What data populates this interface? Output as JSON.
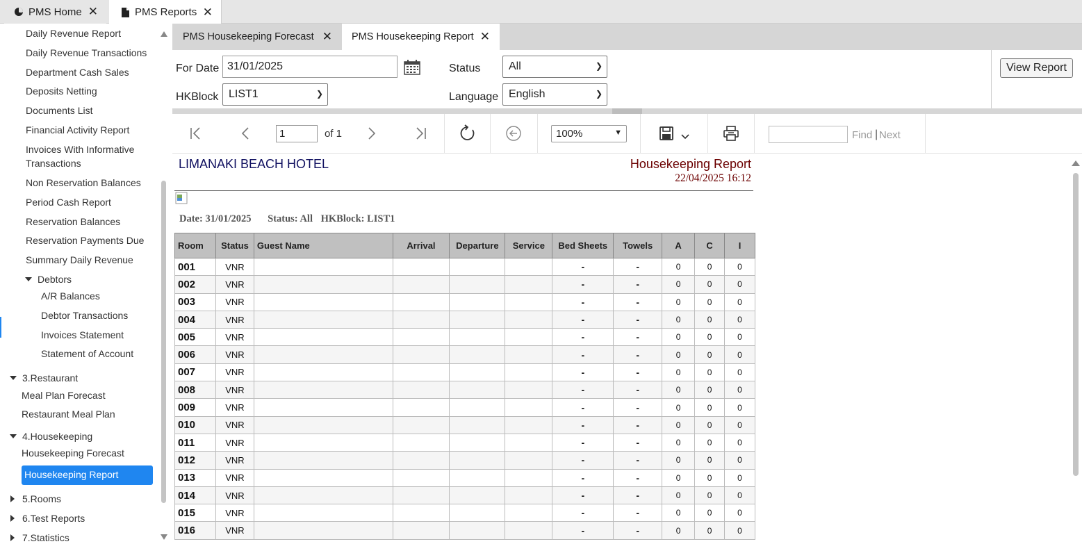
{
  "top_tabs": [
    {
      "label": "PMS Home",
      "icon": "pie-chart-icon"
    },
    {
      "label": "PMS Reports",
      "icon": "document-icon"
    }
  ],
  "sidebar": {
    "items": [
      "Daily Revenue Report",
      "Daily Revenue Transactions",
      "Department Cash Sales",
      "Deposits Netting",
      "Documents List",
      "Financial Activity Report",
      "Invoices With Informative Transactions",
      "Non Reservation Balances",
      "Period Cash Report",
      "Reservation Balances",
      "Reservation Payments Due",
      "Summary Daily Revenue"
    ],
    "debtors_group": "Debtors",
    "debtors_items": [
      "A/R Balances",
      "Debtor Transactions",
      "Invoices Statement",
      "Statement of Account"
    ],
    "restaurant_group": "3.Restaurant",
    "restaurant_items": [
      "Meal Plan Forecast",
      "Restaurant Meal Plan"
    ],
    "housekeeping_group": "4.Housekeeping",
    "housekeeping_items": [
      "Housekeeping Forecast"
    ],
    "active_item": "Housekeeping Report",
    "rooms_group": "5.Rooms",
    "test_group": "6.Test Reports",
    "stats_group": "7.Statistics"
  },
  "inner_tabs": [
    {
      "label": "PMS Housekeeping Forecast"
    },
    {
      "label": "PMS Housekeeping Report"
    }
  ],
  "params": {
    "for_date_label": "For Date",
    "for_date_value": "31/01/2025",
    "status_label": "Status",
    "status_value": "All",
    "hkblock_label": "HKBlock",
    "hkblock_value": "LIST1",
    "language_label": "Language",
    "language_value": "English",
    "view_report_label": "View Report"
  },
  "toolbar": {
    "page_value": "1",
    "of_text": "of 1",
    "zoom_value": "100%",
    "find_label": "Find",
    "next_label": "Next"
  },
  "report": {
    "hotel_name": "LIMANAKI BEACH HOTEL",
    "title": "Housekeeping Report",
    "generated": "22/04/2025 16:12",
    "filter_date": "Date: 31/01/2025",
    "filter_status": "Status:  All",
    "filter_hkblock": "HKBlock: LIST1",
    "columns": [
      "Room",
      "Status",
      "Guest Name",
      "Arrival",
      "Departure",
      "Service",
      "Bed Sheets",
      "Towels",
      "A",
      "C",
      "I"
    ],
    "rows": [
      {
        "room": "001",
        "status": "VNR",
        "guest": "",
        "arrival": "",
        "departure": "",
        "service": "",
        "bed_sheets": "-",
        "towels": "-",
        "a": "0",
        "c": "0",
        "i": "0"
      },
      {
        "room": "002",
        "status": "VNR",
        "guest": "",
        "arrival": "",
        "departure": "",
        "service": "",
        "bed_sheets": "-",
        "towels": "-",
        "a": "0",
        "c": "0",
        "i": "0"
      },
      {
        "room": "003",
        "status": "VNR",
        "guest": "",
        "arrival": "",
        "departure": "",
        "service": "",
        "bed_sheets": "-",
        "towels": "-",
        "a": "0",
        "c": "0",
        "i": "0"
      },
      {
        "room": "004",
        "status": "VNR",
        "guest": "",
        "arrival": "",
        "departure": "",
        "service": "",
        "bed_sheets": "-",
        "towels": "-",
        "a": "0",
        "c": "0",
        "i": "0"
      },
      {
        "room": "005",
        "status": "VNR",
        "guest": "",
        "arrival": "",
        "departure": "",
        "service": "",
        "bed_sheets": "-",
        "towels": "-",
        "a": "0",
        "c": "0",
        "i": "0"
      },
      {
        "room": "006",
        "status": "VNR",
        "guest": "",
        "arrival": "",
        "departure": "",
        "service": "",
        "bed_sheets": "-",
        "towels": "-",
        "a": "0",
        "c": "0",
        "i": "0"
      },
      {
        "room": "007",
        "status": "VNR",
        "guest": "",
        "arrival": "",
        "departure": "",
        "service": "",
        "bed_sheets": "-",
        "towels": "-",
        "a": "0",
        "c": "0",
        "i": "0"
      },
      {
        "room": "008",
        "status": "VNR",
        "guest": "",
        "arrival": "",
        "departure": "",
        "service": "",
        "bed_sheets": "-",
        "towels": "-",
        "a": "0",
        "c": "0",
        "i": "0"
      },
      {
        "room": "009",
        "status": "VNR",
        "guest": "",
        "arrival": "",
        "departure": "",
        "service": "",
        "bed_sheets": "-",
        "towels": "-",
        "a": "0",
        "c": "0",
        "i": "0"
      },
      {
        "room": "010",
        "status": "VNR",
        "guest": "",
        "arrival": "",
        "departure": "",
        "service": "",
        "bed_sheets": "-",
        "towels": "-",
        "a": "0",
        "c": "0",
        "i": "0"
      },
      {
        "room": "011",
        "status": "VNR",
        "guest": "",
        "arrival": "",
        "departure": "",
        "service": "",
        "bed_sheets": "-",
        "towels": "-",
        "a": "0",
        "c": "0",
        "i": "0"
      },
      {
        "room": "012",
        "status": "VNR",
        "guest": "",
        "arrival": "",
        "departure": "",
        "service": "",
        "bed_sheets": "-",
        "towels": "-",
        "a": "0",
        "c": "0",
        "i": "0"
      },
      {
        "room": "013",
        "status": "VNR",
        "guest": "",
        "arrival": "",
        "departure": "",
        "service": "",
        "bed_sheets": "-",
        "towels": "-",
        "a": "0",
        "c": "0",
        "i": "0"
      },
      {
        "room": "014",
        "status": "VNR",
        "guest": "",
        "arrival": "",
        "departure": "",
        "service": "",
        "bed_sheets": "-",
        "towels": "-",
        "a": "0",
        "c": "0",
        "i": "0"
      },
      {
        "room": "015",
        "status": "VNR",
        "guest": "",
        "arrival": "",
        "departure": "",
        "service": "",
        "bed_sheets": "-",
        "towels": "-",
        "a": "0",
        "c": "0",
        "i": "0"
      },
      {
        "room": "016",
        "status": "VNR",
        "guest": "",
        "arrival": "",
        "departure": "",
        "service": "",
        "bed_sheets": "-",
        "towels": "-",
        "a": "0",
        "c": "0",
        "i": "0"
      }
    ]
  },
  "colors": {
    "accent": "#1f86f0",
    "report_title": "#6b0000",
    "hotel_name": "#101060",
    "table_header": "#c0c0c0"
  }
}
